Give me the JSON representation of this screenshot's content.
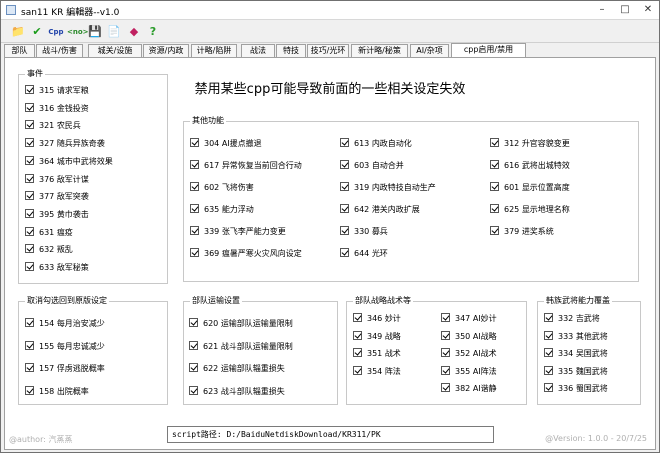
{
  "window": {
    "title": "san11 KR 編輯器--v1.0",
    "minimize": "–",
    "maximize": "□",
    "close": "✕"
  },
  "toolbar": [
    {
      "name": "open-file-icon",
      "glyph": "📁",
      "color": "#e8a400"
    },
    {
      "name": "checkmark-icon",
      "glyph": "✔",
      "color": "#1a9c1a"
    },
    {
      "name": "cpp-icon",
      "glyph": "Cpp",
      "color": "#2244aa"
    },
    {
      "name": "code-icon",
      "glyph": "<no>",
      "color": "#2a8a2a"
    },
    {
      "name": "save-icon",
      "glyph": "💾",
      "color": "#a0204a"
    },
    {
      "name": "document-icon",
      "glyph": "📄",
      "color": "#4488cc"
    },
    {
      "name": "heart-icon",
      "glyph": "◆",
      "color": "#c02060"
    },
    {
      "name": "help-icon",
      "glyph": "?",
      "color": "#2a9c2a"
    }
  ],
  "tabs": [
    "部队",
    "战斗/伤害",
    "城关/设施",
    "资源/内政",
    "计略/陷阱",
    "战法",
    "特技",
    "技巧/光环",
    "新计略/秘策",
    "AI/杂项",
    "cpp启用/禁用"
  ],
  "headline": "禁用某些cpp可能导致前面的一些相关设定失效",
  "events": {
    "title": "事件",
    "items": [
      "315 请求军粮",
      "316 金钱投资",
      "321 农民兵",
      "327 随兵异族奇袭",
      "364 城市中武将效果",
      "376 敌军计谋",
      "377 敌军突袭",
      "395 黄巾袭击",
      "631 瘟疫",
      "632 叛乱",
      "633 敌军秘策"
    ]
  },
  "other": {
    "title": "其他功能",
    "col1": [
      "304 AI援点撤退",
      "617 异常恢复当前回合行动",
      "602 飞将伤害",
      "635 能力浮动",
      "339 张飞李严能力变更",
      "369 瘟暑严寒火灾风向设定"
    ],
    "col2": [
      "613 内政自动化",
      "603 自动合并",
      "319 内政特技自动生产",
      "642 港关内政扩展",
      "330 募兵",
      "644 光环"
    ],
    "col3": [
      "312 升官容貌变更",
      "616 武将出城特效",
      "601 显示位置高度",
      "625 显示地理名称",
      "379 进奖系统"
    ]
  },
  "cancel": {
    "title": "取消勾选回到原版设定",
    "items": [
      "154 每月治安减少",
      "155 每月忠诚减少",
      "157 俘虏逃脱概率",
      "158 出院概率"
    ]
  },
  "transport": {
    "title": "部队运输设置",
    "items": [
      "620 运输部队运输量限制",
      "621 战斗部队运输量限制",
      "622 运输部队辎重损失",
      "623 战斗部队辎重损失"
    ]
  },
  "tactics": {
    "title": "部队战略战术等",
    "col1": [
      "346 妙计",
      "349 战略",
      "351 战术",
      "354 阵法"
    ],
    "col2": [
      "347 AI妙计",
      "350 AI战略",
      "352 AI战术",
      "355 AI阵法",
      "382 AI谐静"
    ]
  },
  "nations": {
    "title": "韩族武将能力覆盖",
    "items": [
      "332 吉武将",
      "333 其他武将",
      "334 吴国武将",
      "335 魏国武将",
      "336 蜀国武将"
    ]
  },
  "footer": {
    "author": "@author: 汽蒸蒸",
    "path": "script路径: D:/BaiduNetdiskDownload/KR311/PK",
    "version": "@Version: 1.0.0 - 20/7/25"
  }
}
